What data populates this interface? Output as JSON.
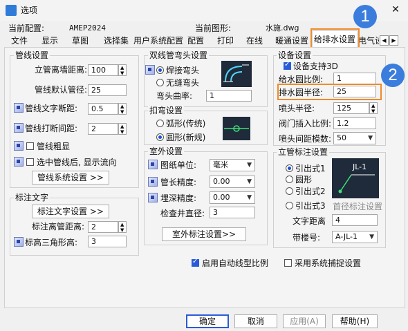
{
  "window": {
    "title": "选项"
  },
  "header": {
    "current_config_label": "当前配置:",
    "current_config_value": "AMEP2024",
    "current_drawing_label": "当前图形:",
    "current_drawing_value": "水施.dwg"
  },
  "tabs": [
    "文件",
    "显示",
    "草图",
    "选择集",
    "用户系统配置",
    "配置",
    "打印",
    "在线",
    "暖通设置",
    "给排水设置",
    "电气设"
  ],
  "active_tab": "给排水设置",
  "pipe_settings": {
    "title": "管线设置",
    "wall_distance_label": "立管离墙距离:",
    "wall_distance_value": "100",
    "default_diameter_label": "管线默认管径:",
    "default_diameter_value": "25",
    "text_break_label": "管线文字断距:",
    "text_break_value": "0.5",
    "break_spacing_label": "管线打断间距:",
    "break_spacing_value": "2",
    "bold_label": "管线粗显",
    "flow_label": "选中管线后, 显示流向",
    "system_button": "管线系统设置 >>"
  },
  "annotation_text": {
    "title": "标注文字",
    "text_button": "标注文字设置 >>",
    "offset_label": "标注离管距离:",
    "offset_value": "2",
    "triangle_label": "标高三角形高:",
    "triangle_value": "3"
  },
  "double_elbow": {
    "title": "双线管弯头设置",
    "weld_label": "焊接弯头",
    "seamless_label": "无缝弯头",
    "curvature_label": "弯头曲率:",
    "curvature_value": "1"
  },
  "bend": {
    "title": "扣弯设置",
    "arc_label": "弧形(传统)",
    "circle_label": "圆形(新规)"
  },
  "outdoor": {
    "title": "室外设置",
    "unit_label": "图纸单位:",
    "unit_value": "毫米",
    "length_label": "管长精度:",
    "length_value": "0.00",
    "depth_label": "埋深精度:",
    "depth_value": "0.00",
    "well_label": "检查井直径:",
    "well_value": "3",
    "outdoor_button": "室外标注设置>>"
  },
  "device": {
    "title": "设备设置",
    "support3d_label": "设备支持3D",
    "water_ratio_label": "给水圆比例:",
    "water_ratio_value": "1",
    "drain_radius_label": "排水圆半径:",
    "drain_radius_value": "25",
    "spray_radius_label": "喷头半径:",
    "spray_radius_value": "125",
    "valve_ratio_label": "阀门插入比例:",
    "valve_ratio_value": "1.2",
    "spray_spacing_label": "喷头间距模数:",
    "spray_spacing_value": "50"
  },
  "riser": {
    "title": "立管标注设置",
    "opt1": "引出式1",
    "opt2": "圆形",
    "opt3": "引出式2",
    "opt4": "引出式3",
    "preview_text": "JL-1",
    "head_button": "首径标注设置",
    "text_distance_label": "文字距离",
    "text_distance_value": "4",
    "building_label": "带楼号:",
    "building_value": "A-JL-1"
  },
  "bottom_options": {
    "auto_linetype_label": "启用自动线型比例",
    "snap_label": "采用系统捕捉设置"
  },
  "footer": {
    "ok": "确定",
    "cancel": "取消",
    "apply": "应用(A)",
    "help": "帮助(H)"
  },
  "annotations": {
    "badge1": "1",
    "badge2": "2"
  },
  "colors": {
    "accent": "#2a5bd7",
    "highlight": "#f08a2a",
    "badge": "#3b7ddd"
  }
}
